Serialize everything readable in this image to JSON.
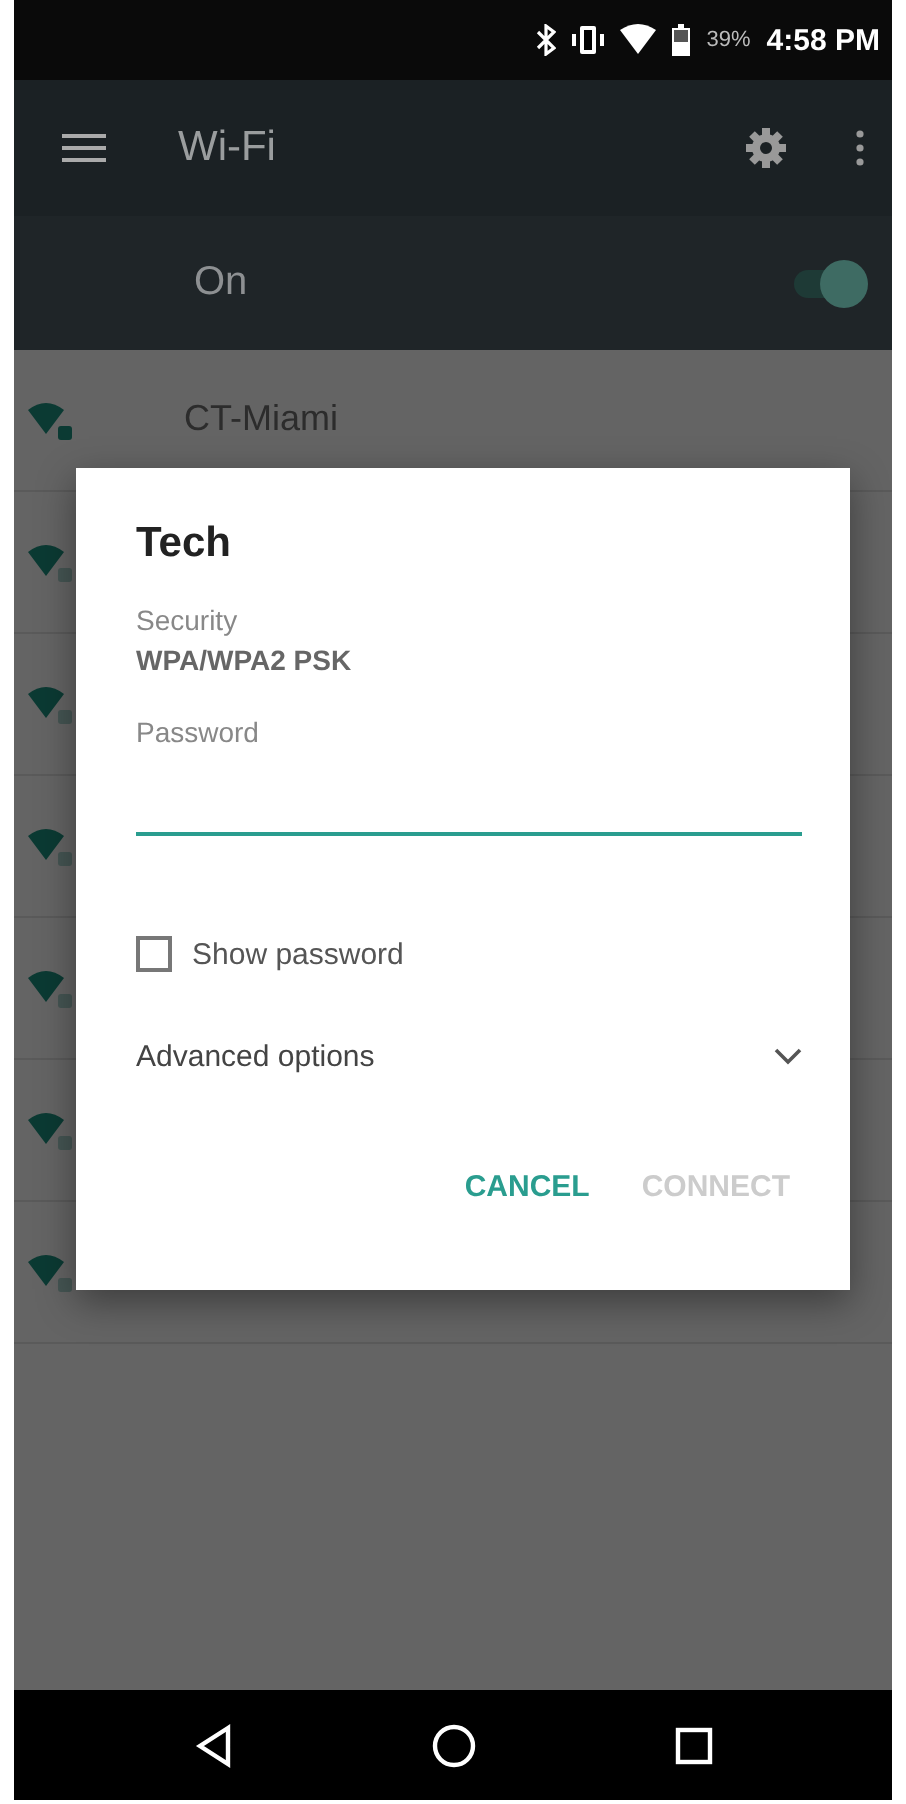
{
  "status_bar": {
    "battery": "39%",
    "time": "4:58 PM"
  },
  "toolbar": {
    "title": "Wi-Fi"
  },
  "wifi_switch": {
    "label": "On",
    "on": true
  },
  "networks": [
    {
      "name": "CT-Miami",
      "connected": true
    },
    {
      "connected": false
    },
    {
      "connected": false
    },
    {
      "connected": false
    },
    {
      "connected": false
    },
    {
      "connected": false
    },
    {
      "connected": false
    }
  ],
  "dialog": {
    "title": "Tech",
    "security_label": "Security",
    "security_value": "WPA/WPA2 PSK",
    "password_label": "Password",
    "show_password": {
      "label": "Show password",
      "checked": false
    },
    "advanced": {
      "label": "Advanced options",
      "expanded": false
    },
    "buttons": [
      {
        "label": "CANCEL",
        "disabled": false
      },
      {
        "label": "CONNECT",
        "disabled": true
      }
    ]
  }
}
